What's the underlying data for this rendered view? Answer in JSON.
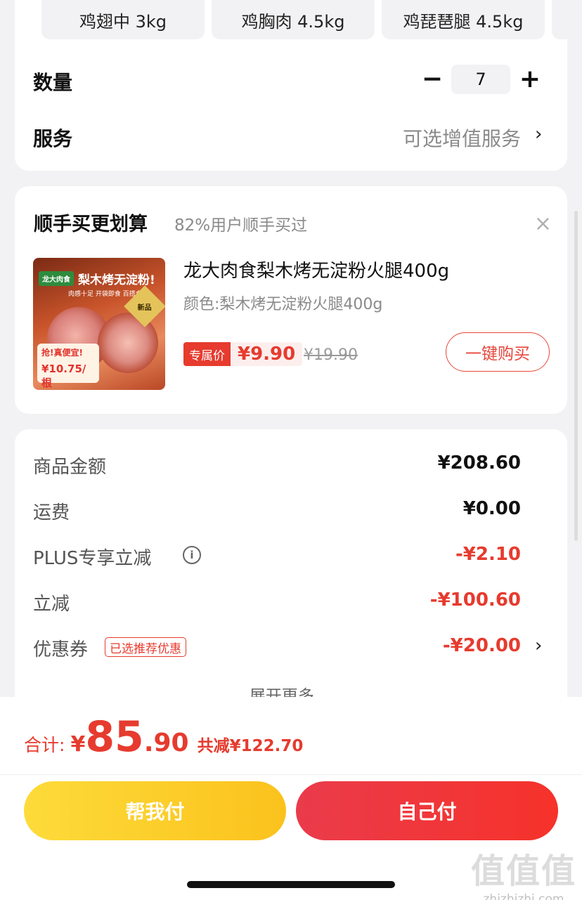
{
  "spec_chips": [
    "鸡翅中 3kg",
    "鸡胸肉 4.5kg",
    "鸡琵琶腿 4.5kg"
  ],
  "quantity": {
    "label": "数量",
    "minus": "−",
    "value": "7",
    "plus": "+"
  },
  "service": {
    "label": "服务",
    "value": "可选增值服务",
    "chevron": "›"
  },
  "bundle": {
    "title": "顺手买更划算",
    "subtitle": "82%用户顺手买过",
    "close": "×",
    "product": {
      "image_banner": "梨木烤无淀粉!",
      "image_logo": "龙大肉食",
      "image_sub": "肉感十足 开袋即食 百搭食材",
      "image_new": "新品",
      "image_promo": "抢!真便宜!",
      "image_price": "¥10.75/根",
      "name": "龙大肉食梨木烤无淀粉火腿400g",
      "spec": "颜色:梨木烤无淀粉火腿400g",
      "exclusive_label": "专属价",
      "exclusive_price": "¥9.90",
      "original_price": "¥19.90",
      "buy_button": "一键购买"
    }
  },
  "summary": {
    "rows": [
      {
        "label": "商品金额",
        "value": "¥208.60"
      },
      {
        "label": "运费",
        "value": "¥0.00"
      },
      {
        "label": "PLUS专享立减",
        "value": "-¥2.10"
      },
      {
        "label": "立减",
        "value": "-¥100.60"
      },
      {
        "label": "优惠券",
        "value": "-¥20.00"
      }
    ],
    "coupon_tag": "已选推荐优惠",
    "info_icon": "i",
    "expand_more": "展开更多 ⌄"
  },
  "footer": {
    "total_label": "合计:",
    "currency": "¥",
    "total_int": "85",
    "total_dec": ".90",
    "saved": "共减¥122.70",
    "help_pay": "帮我付",
    "self_pay": "自己付"
  },
  "watermark": {
    "big": "值值值",
    "small": "zhizhizhi.com"
  },
  "colors": {
    "accent_red": "#e63b2e",
    "help_pay_yellow": "#fbc21c",
    "self_pay_red": "#f6322a"
  }
}
